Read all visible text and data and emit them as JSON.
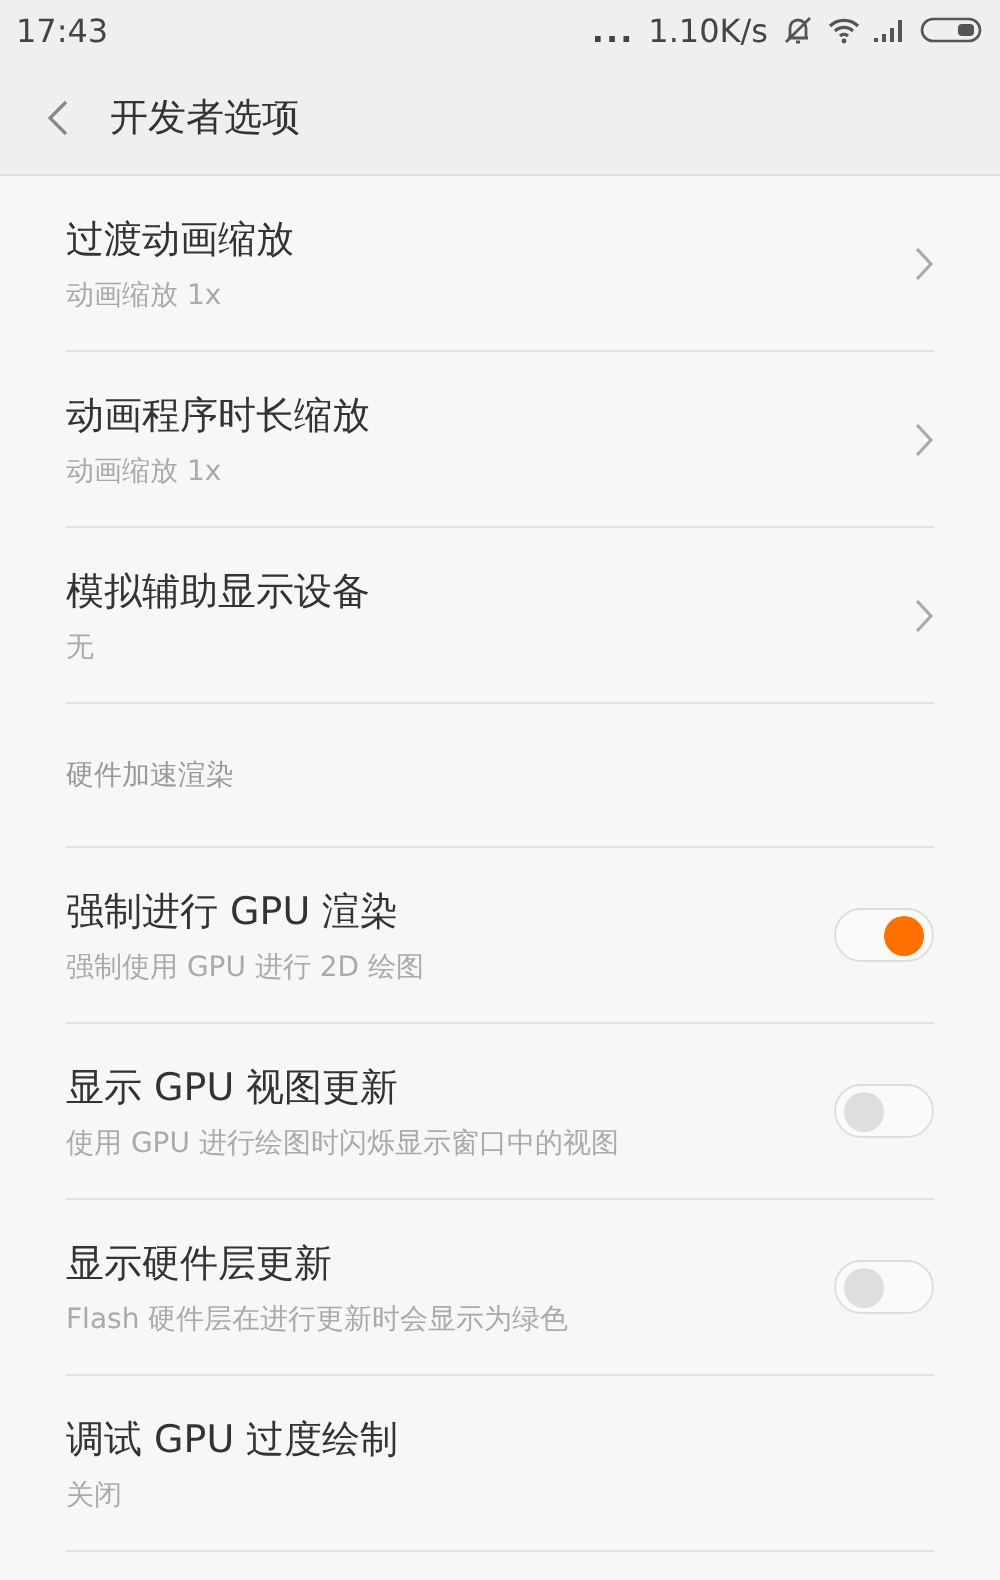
{
  "status_bar": {
    "time": "17:43",
    "dots": "...",
    "speed": "1.10K/s"
  },
  "header": {
    "title": "开发者选项"
  },
  "groups": [
    {
      "items": [
        {
          "kind": "nav",
          "title": "过渡动画缩放",
          "subtitle": "动画缩放 1x"
        },
        {
          "kind": "nav",
          "title": "动画程序时长缩放",
          "subtitle": "动画缩放 1x"
        },
        {
          "kind": "nav",
          "title": "模拟辅助显示设备",
          "subtitle": "无"
        }
      ]
    },
    {
      "heading": "硬件加速渲染",
      "items": [
        {
          "kind": "toggle",
          "title": "强制进行 GPU 渲染",
          "subtitle": "强制使用 GPU 进行 2D 绘图",
          "on": true
        },
        {
          "kind": "toggle",
          "title": "显示 GPU 视图更新",
          "subtitle": "使用 GPU 进行绘图时闪烁显示窗口中的视图",
          "on": false
        },
        {
          "kind": "toggle",
          "title": "显示硬件层更新",
          "subtitle": "Flash 硬件层在进行更新时会显示为绿色",
          "on": false
        },
        {
          "kind": "plain",
          "title": "调试 GPU 过度绘制",
          "subtitle": "关闭"
        }
      ]
    }
  ]
}
